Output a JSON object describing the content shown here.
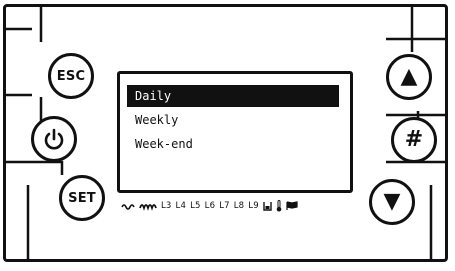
{
  "keys": {
    "esc_label": "ESC",
    "set_label": "SET",
    "power_icon": "power-icon",
    "up_glyph": "▲",
    "hash_glyph": "#",
    "down_glyph": "▼"
  },
  "menu": {
    "items": [
      {
        "label": "Daily",
        "selected": true
      },
      {
        "label": "Weekly",
        "selected": false
      },
      {
        "label": "Week-end",
        "selected": false
      }
    ]
  },
  "status_indicators": {
    "fan_icon": "fan-icon",
    "resistance_icon": "heating-element-icon",
    "levels": [
      "L3",
      "L4",
      "L5",
      "L6",
      "L7",
      "L8",
      "L9"
    ],
    "extra_icons": [
      "tank-icon",
      "thermometer-icon",
      "flag-icon"
    ]
  },
  "colors": {
    "ink": "#111111",
    "background": "#ffffff"
  }
}
